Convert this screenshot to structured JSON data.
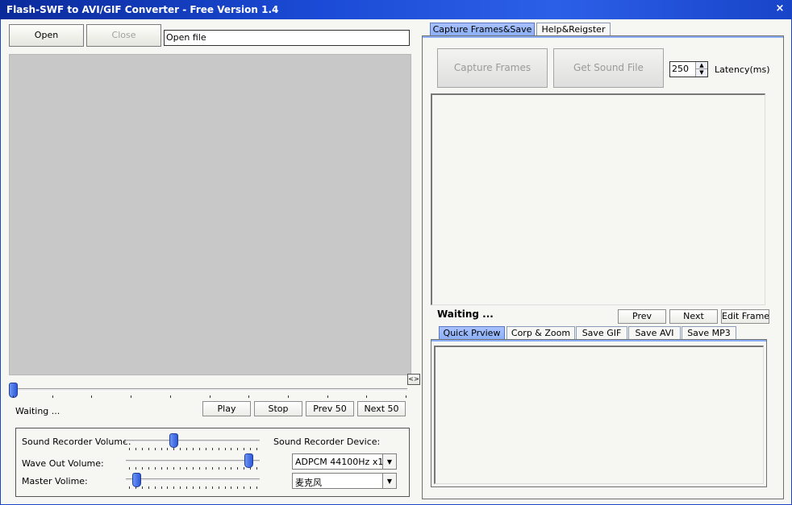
{
  "window": {
    "title": "Flash-SWF to AVI/GIF Converter - Free Version 1.4",
    "close_glyph": "×"
  },
  "left": {
    "open_label": "Open",
    "close_label": "Close",
    "file_path": "Open file",
    "status": "Waiting ...",
    "expand_glyph": "<>",
    "playback": {
      "play": "Play",
      "stop": "Stop",
      "prev50": "Prev 50",
      "next50": "Next 50"
    },
    "progress": 0
  },
  "sound": {
    "recorder_volume_label": "Sound Recorder Volume:",
    "wave_out_label": "Wave Out Volume:",
    "master_label": "Master Volime:",
    "device_label": "Sound Recorder Device:",
    "format_value": "ADPCM 44100Hz x1",
    "device_value": "麦克风",
    "recorder_volume_level": 0.35,
    "wave_out_level": 0.95,
    "master_level": 0.05
  },
  "right": {
    "tabs": [
      "Capture Frames&Save",
      "Help&Reigster"
    ],
    "capture_frames_label": "Capture Frames",
    "get_sound_label": "Get Sound File",
    "latency_value": "250",
    "latency_label": "Latency(ms)",
    "status": "Waiting ...",
    "prev_label": "Prev",
    "next_label": "Next",
    "edit_frame_label": "Edit Frame",
    "sub_tabs": [
      "Quick Prview",
      "Corp & Zoom",
      "Save GIF",
      "Save AVI",
      "Save MP3"
    ]
  }
}
